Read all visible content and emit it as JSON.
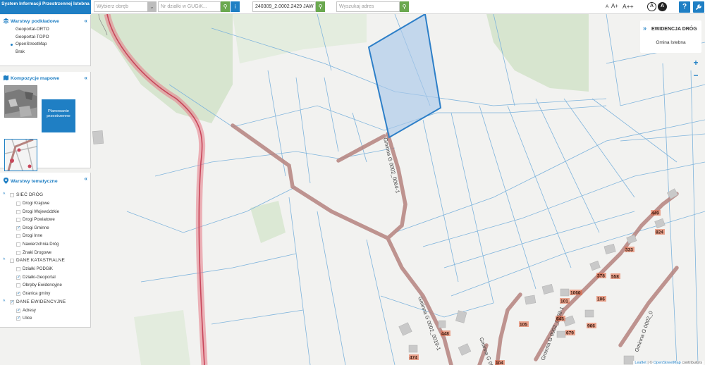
{
  "header": {
    "brand": "System Informacji Przestrzennej Istebna",
    "region_placeholder": "Wybierz obręb",
    "parcel_placeholder": "Nr działki w GUGiK...",
    "parcel_value": "240309_2.0002.2429 JAW",
    "address_placeholder": "Wyszukaj adres",
    "font_small": "A",
    "font_medium": "A+",
    "font_large": "A++",
    "contrast_normal": "A",
    "contrast_high": "A",
    "help": "?",
    "tools_icon": "wrench-icon"
  },
  "base_layers": {
    "title": "Warstwy podkładowe",
    "options": [
      {
        "label": "Geoportal-ORTO",
        "selected": false
      },
      {
        "label": "Geoportal-TOPO",
        "selected": false
      },
      {
        "label": "OpenStreetMap",
        "selected": true
      },
      {
        "label": "Brak",
        "selected": false
      }
    ]
  },
  "compositions": {
    "title": "Kompozycje mapowe",
    "planning_label": "Planowanie przestrzenne"
  },
  "thematic": {
    "title": "Warstwy tematyczne",
    "groups": [
      {
        "label": "SIEĆ DRÓG",
        "checked": false,
        "items": [
          {
            "label": "Drogi Krajowe",
            "checked": false
          },
          {
            "label": "Drogi Wojewódzkie",
            "checked": false
          },
          {
            "label": "Drogi Powiatowe",
            "checked": false
          },
          {
            "label": "Drogi Gminne",
            "checked": true
          },
          {
            "label": "Drogi Inne",
            "checked": false
          },
          {
            "label": "Nawierzchnia Dróg",
            "checked": false
          },
          {
            "label": "Znaki Drogowe",
            "checked": false
          }
        ]
      },
      {
        "label": "DANE KATASTRALNE",
        "checked": false,
        "items": [
          {
            "label": "Działki PODGiK",
            "checked": false
          },
          {
            "label": "Działki-Geoportal",
            "checked": true
          },
          {
            "label": "Obręby Ewidencyjne",
            "checked": false
          },
          {
            "label": "Granica gminy",
            "checked": true
          }
        ]
      },
      {
        "label": "DANE EWIDENCYJNE",
        "checked": true,
        "items": [
          {
            "label": "Adresy",
            "checked": true
          },
          {
            "label": "Ulice",
            "checked": true
          }
        ]
      }
    ]
  },
  "right_panel": {
    "title": "EWIDENCJA DRÓG",
    "subtitle": "Gmina Istebna"
  },
  "map": {
    "road_labels": [
      "Gminna G 0002_0064-1",
      "Gminna G 0002_0019-1",
      "Gminna G 0002_0",
      "Gminna G 0002_0058-1",
      "Gminna G 0002_0"
    ],
    "house_numbers": [
      "449",
      "824",
      "333",
      "378",
      "558",
      "1060",
      "101",
      "106",
      "105",
      "645",
      "679",
      "966",
      "448",
      "474",
      "104",
      "104"
    ],
    "zoom_in": "+",
    "zoom_out": "−",
    "attribution_leaflet": "Leaflet",
    "attribution_sep": " | © ",
    "attribution_osm": "OpenStreetMap",
    "attribution_tail": " contributors"
  }
}
